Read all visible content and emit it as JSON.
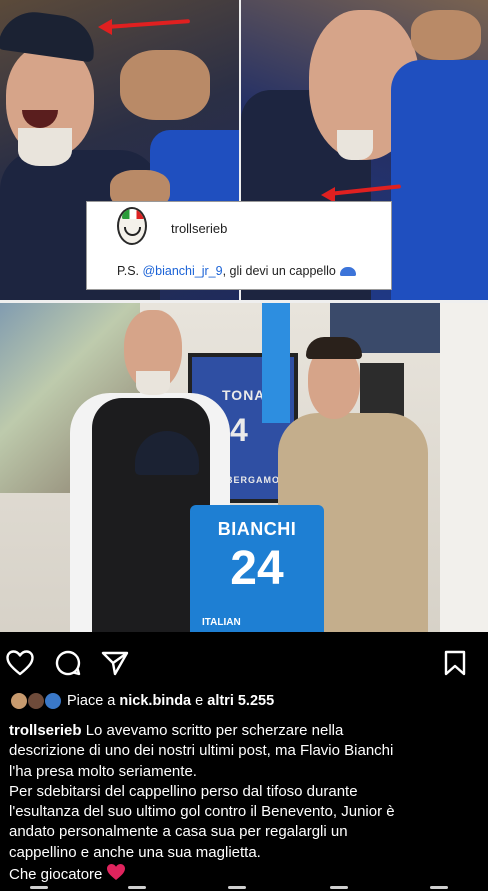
{
  "post": {
    "photo_jersey_frame_name": "TONALI",
    "photo_frame_number": "4",
    "photo_frame_sponsor": "BERGAMO",
    "jersey_name": "BIANCHI",
    "jersey_number": "24",
    "jersey_sponsor": "ITALIAN"
  },
  "comment_card": {
    "username": "trollserieb",
    "text_prefix": "P.S. ",
    "mention": "@bianchi_jr_9",
    "text_suffix": ", gli devi un cappello"
  },
  "actions": {
    "icons": [
      "heart-icon",
      "comment-icon",
      "share-icon",
      "bookmark-icon"
    ]
  },
  "likes": {
    "prefix": "Piace a ",
    "user": "nick.binda",
    "middle": " e ",
    "others": "altri 5.255"
  },
  "caption": {
    "username": "trollserieb",
    "lines": [
      " Lo avevamo scritto per scherzare nella",
      "descrizione di uno dei nostri ultimi post, ma Flavio Bianchi",
      "l'ha presa molto seriamente.",
      "Per sdebitarsi del cappellino perso dal tifoso durante",
      "l'esultanza del suo ultimo gol contro il Benevento, Junior è",
      "andato personalmente a casa sua per regalargli un",
      "cappellino e anche una sua maglietta.",
      "Che giocatore"
    ]
  },
  "colors": {
    "background": "#000000",
    "text": "#ffffff",
    "mention": "#1a62d6",
    "heart": "#e0245e",
    "arrow": "#e02020",
    "jersey": "#1e7fd3"
  }
}
